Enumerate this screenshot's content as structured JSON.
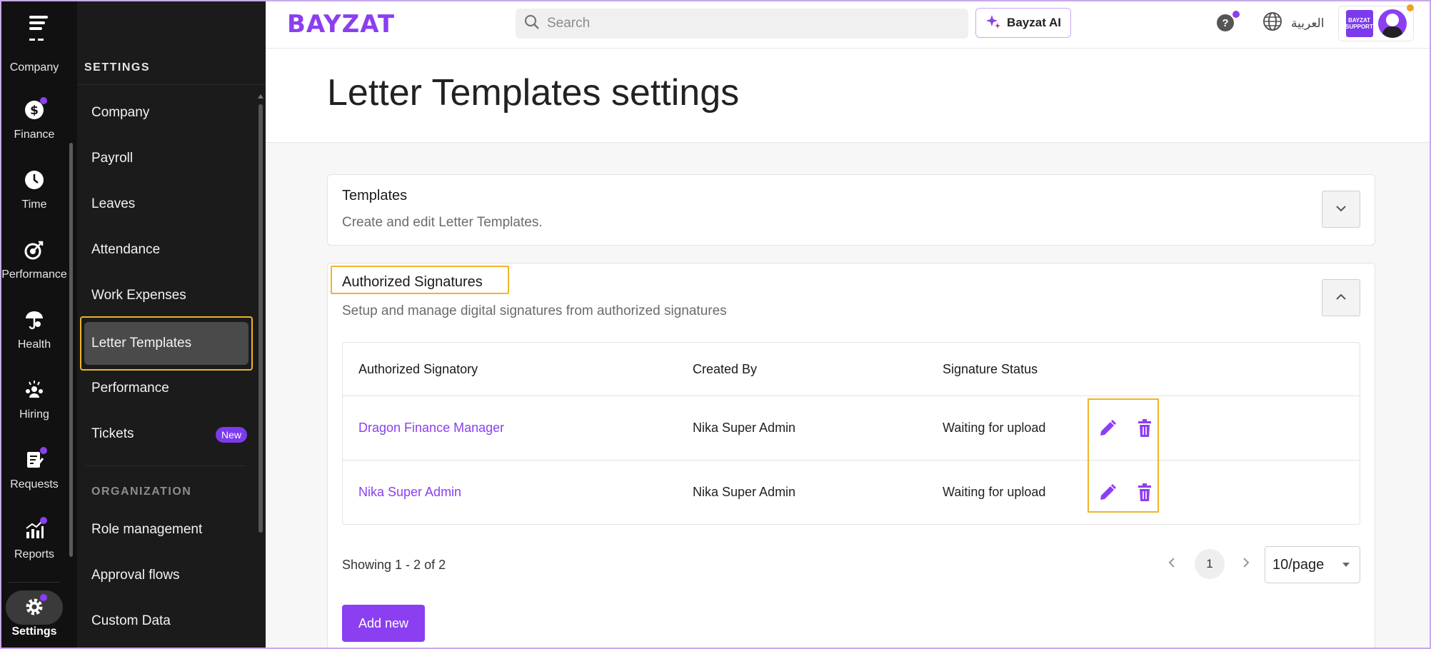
{
  "colors": {
    "accent": "#8b3ff0",
    "highlight": "#f0b429",
    "rail_bg": "#111111",
    "sidebar_bg": "#1b1b1b"
  },
  "rail": {
    "items": [
      {
        "label": "Company",
        "icon": "building-icon"
      },
      {
        "label": "Finance",
        "icon": "dollar-icon"
      },
      {
        "label": "Time",
        "icon": "clock-icon"
      },
      {
        "label": "Performance",
        "icon": "target-icon"
      },
      {
        "label": "Health",
        "icon": "umbrella-heart-icon"
      },
      {
        "label": "Hiring",
        "icon": "people-icon"
      },
      {
        "label": "Requests",
        "icon": "clipboard-icon"
      },
      {
        "label": "Reports",
        "icon": "chart-icon"
      },
      {
        "label": "Settings",
        "icon": "gear-icon"
      }
    ]
  },
  "sidebar": {
    "heading": "SETTINGS",
    "items": [
      {
        "label": "Company"
      },
      {
        "label": "Payroll"
      },
      {
        "label": "Leaves"
      },
      {
        "label": "Attendance"
      },
      {
        "label": "Work Expenses"
      },
      {
        "label": "Letter Templates"
      },
      {
        "label": "Performance"
      },
      {
        "label": "Tickets",
        "badge": "New"
      }
    ],
    "org_heading": "ORGANIZATION",
    "org_items": [
      {
        "label": "Role management"
      },
      {
        "label": "Approval flows"
      },
      {
        "label": "Custom Data"
      }
    ]
  },
  "topbar": {
    "logo": "BAYZAT",
    "search_placeholder": "Search",
    "ai_label": "Bayzat AI",
    "help_label": "?",
    "language": "العربية",
    "biz_badge": "BAYZAT SUPPORT"
  },
  "page": {
    "title": "Letter Templates settings"
  },
  "templates_card": {
    "title": "Templates",
    "description": "Create and edit Letter Templates."
  },
  "signatures_card": {
    "title": "Authorized Signatures",
    "description": "Setup and manage digital signatures from authorized signatures",
    "columns": [
      "Authorized Signatory",
      "Created By",
      "Signature Status"
    ],
    "rows": [
      {
        "signatory": "Dragon Finance Manager",
        "created_by": "Nika Super Admin",
        "status": "Waiting for upload"
      },
      {
        "signatory": "Nika Super Admin",
        "created_by": "Nika Super Admin",
        "status": "Waiting for upload"
      }
    ],
    "showing": "Showing 1 - 2 of 2",
    "current_page": "1",
    "per_page": "10/page",
    "add_label": "Add new"
  }
}
